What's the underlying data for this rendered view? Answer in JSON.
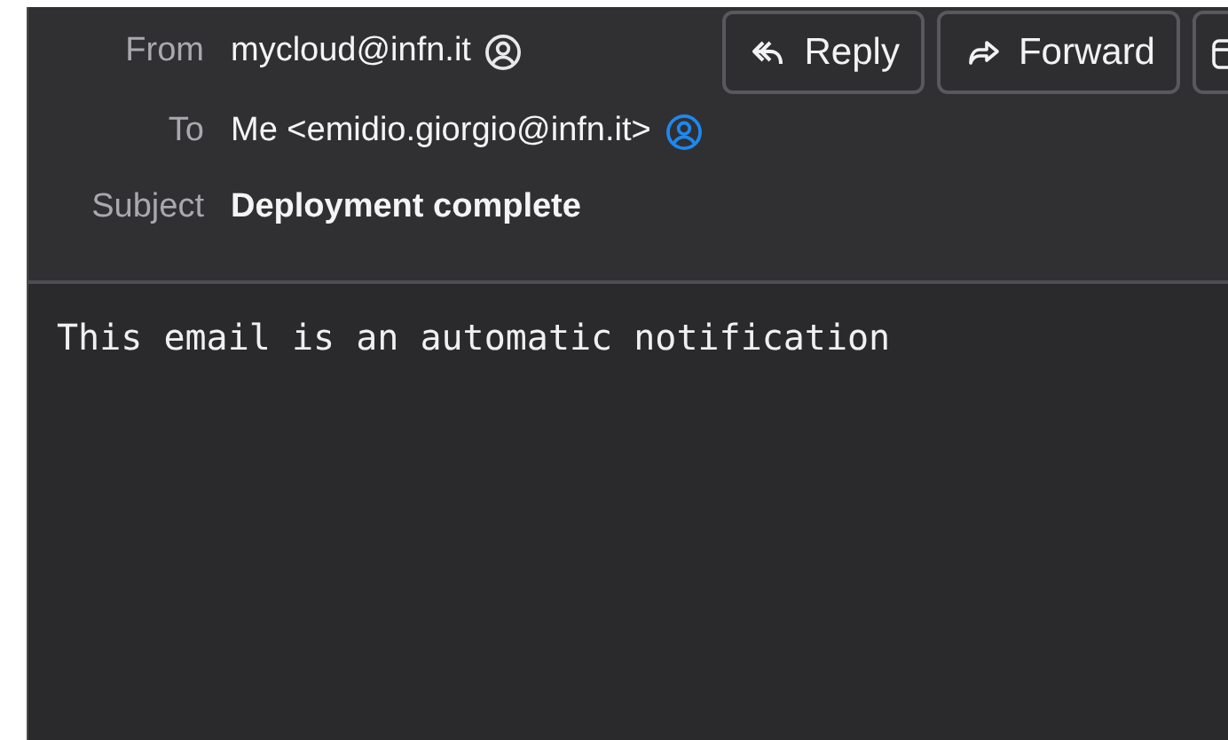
{
  "header": {
    "from": {
      "label": "From",
      "value": "mycloud@infn.it",
      "in_contacts": false
    },
    "to": {
      "label": "To",
      "value": "Me <emidio.giorgio@infn.it>",
      "in_contacts": true
    },
    "subject": {
      "label": "Subject",
      "value": "Deployment complete"
    }
  },
  "buttons": [
    {
      "kind": "reply",
      "label": "Reply"
    },
    {
      "kind": "forward",
      "label": "Forward"
    },
    {
      "kind": "archive"
    }
  ],
  "body": "This email is an automatic notification"
}
